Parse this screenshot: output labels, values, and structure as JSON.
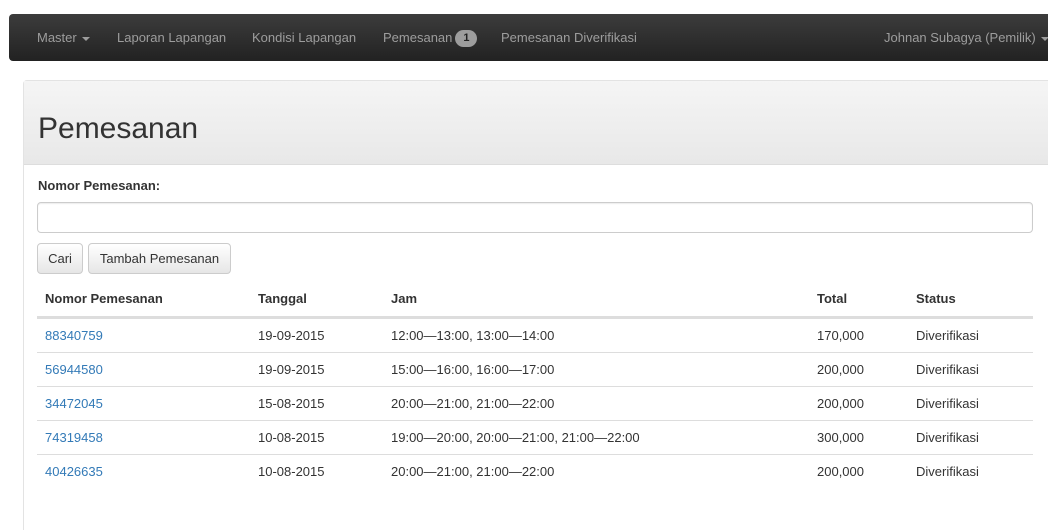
{
  "navbar": {
    "master": "Master",
    "laporan": "Laporan Lapangan",
    "kondisi": "Kondisi Lapangan",
    "pemesanan": "Pemesanan",
    "pemesanan_badge": "1",
    "diverifikasi": "Pemesanan Diverifikasi",
    "user": "Johnan Subagya (Pemilik)"
  },
  "page": {
    "title": "Pemesanan"
  },
  "form": {
    "label": "Nomor Pemesanan:",
    "input_value": "",
    "search_button": "Cari",
    "add_button": "Tambah Pemesanan"
  },
  "table": {
    "headers": [
      "Nomor Pemesanan",
      "Tanggal",
      "Jam",
      "Total",
      "Status"
    ],
    "rows": [
      [
        "88340759",
        "19-09-2015",
        "12:00—13:00, 13:00—14:00",
        "170,000",
        "Diverifikasi"
      ],
      [
        "56944580",
        "19-09-2015",
        "15:00—16:00, 16:00—17:00",
        "200,000",
        "Diverifikasi"
      ],
      [
        "34472045",
        "15-08-2015",
        "20:00—21:00, 21:00—22:00",
        "200,000",
        "Diverifikasi"
      ],
      [
        "74319458",
        "10-08-2015",
        "19:00—20:00, 20:00—21:00, 21:00—22:00",
        "300,000",
        "Diverifikasi"
      ],
      [
        "40426635",
        "10-08-2015",
        "20:00—21:00, 21:00—22:00",
        "200,000",
        "Diverifikasi"
      ]
    ]
  }
}
